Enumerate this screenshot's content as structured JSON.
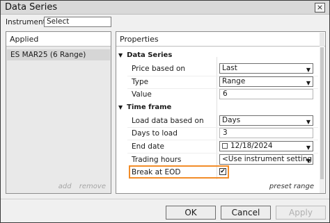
{
  "window": {
    "title": "Data Series",
    "close_icon": "×"
  },
  "instrument": {
    "label": "Instrument",
    "value": "Select"
  },
  "applied": {
    "header": "Applied",
    "items": [
      "ES MAR25 (6 Range)"
    ],
    "add_label": "add",
    "remove_label": "remove"
  },
  "properties": {
    "header": "Properties",
    "sections": {
      "data_series": "Data Series",
      "time_frame": "Time frame"
    },
    "rows": {
      "price_based_on": {
        "label": "Price based on",
        "value": "Last"
      },
      "type": {
        "label": "Type",
        "value": "Range"
      },
      "value": {
        "label": "Value",
        "value": "6"
      },
      "load_data_based_on": {
        "label": "Load data based on",
        "value": "Days"
      },
      "days_to_load": {
        "label": "Days to load",
        "value": "3"
      },
      "end_date": {
        "label": "End date",
        "value": "12/18/2024"
      },
      "trading_hours": {
        "label": "Trading hours",
        "value": "<Use instrument setting..."
      },
      "break_at_eod": {
        "label": "Break at EOD",
        "checked": true,
        "check_glyph": "✔"
      }
    },
    "preset_range": "preset range"
  },
  "buttons": {
    "ok": "OK",
    "cancel": "Cancel",
    "apply": "Apply"
  },
  "colors": {
    "highlight": "#f28c28",
    "selected_item": "#d6d6d6"
  }
}
